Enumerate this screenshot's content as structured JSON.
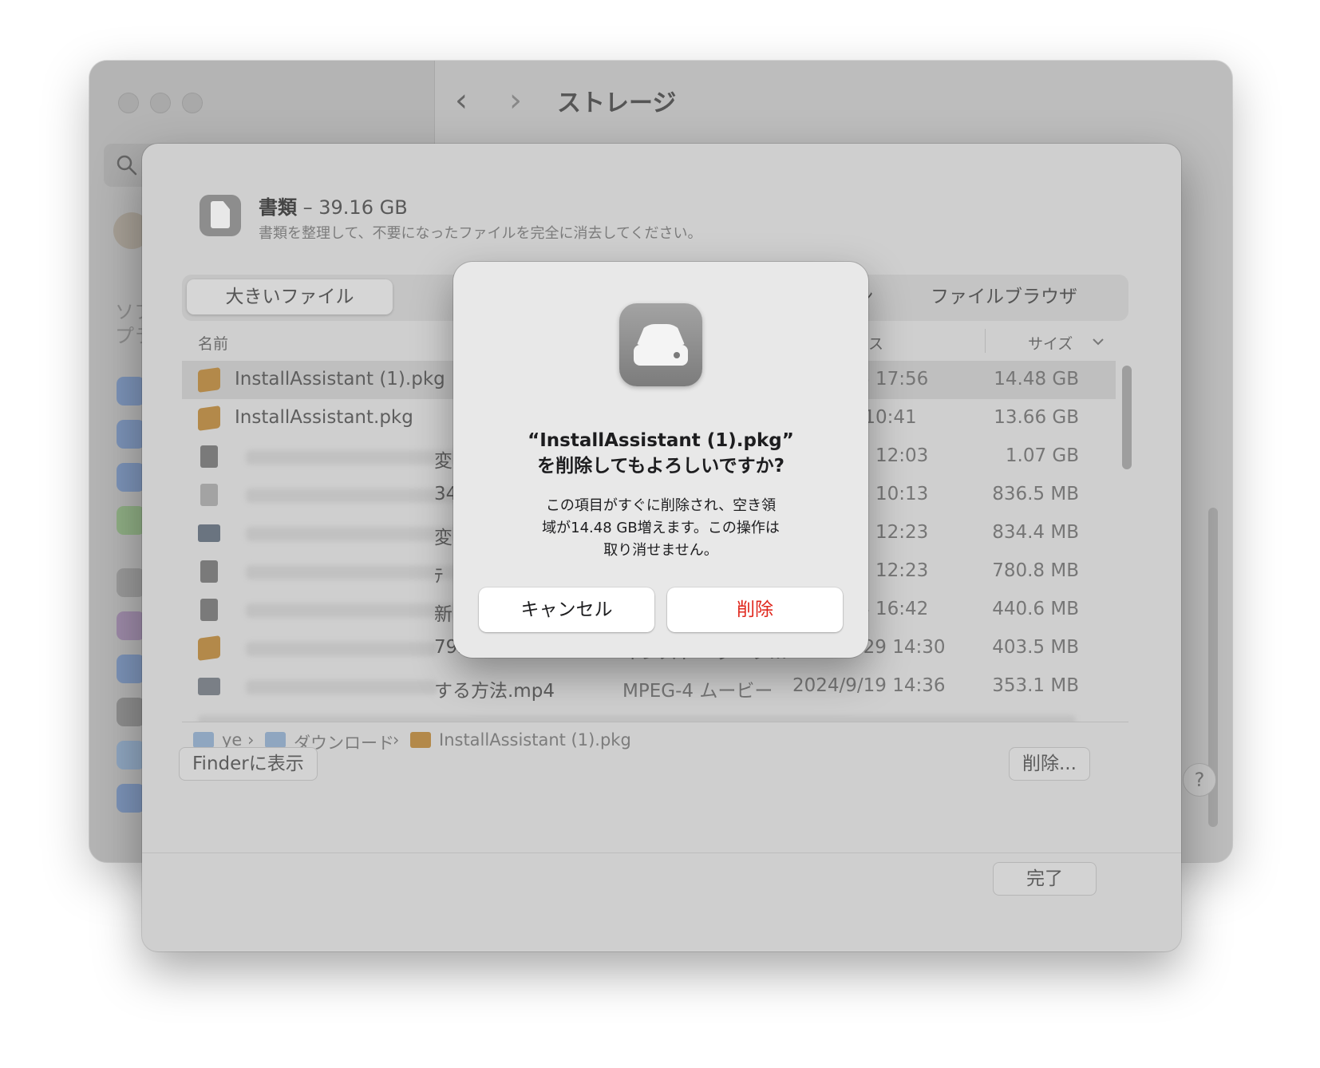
{
  "main_window": {
    "title": "ストレージ",
    "nav_back": "‹",
    "nav_forward": "›",
    "sidebar_text": [
      "ソフ",
      "プラ"
    ]
  },
  "sheet": {
    "title": "書類",
    "title_sep": " – ",
    "size": "39.16 GB",
    "subtitle": "書類を整理して、不要になったファイルを完全に消去してください。",
    "tabs": [
      "大きいファイル",
      "ン",
      "ファイルブラウザ"
    ],
    "columns": {
      "name": "名前",
      "access": "クセス",
      "size": "サイズ"
    },
    "rows": [
      {
        "name": "InstallAssistant (1).pkg",
        "kind": "",
        "date": "9/26 17:56",
        "size": "14.48 GB"
      },
      {
        "name": "InstallAssistant.pkg",
        "kind": "",
        "date": "3/7 10:41",
        "size": "13.66 GB"
      },
      {
        "name": "変",
        "kind": "",
        "date": "6/27 12:03",
        "size": "1.07 GB"
      },
      {
        "name": "34",
        "kind": "",
        "date": "6/18 10:13",
        "size": "836.5 MB"
      },
      {
        "name": "変",
        "kind": "",
        "date": "6/27 12:23",
        "size": "834.4 MB"
      },
      {
        "name": "ﾃ",
        "kind": "",
        "date": "9/19 12:23",
        "size": "780.8 MB"
      },
      {
        "name": "新",
        "kind": "",
        "date": "9/24 16:42",
        "size": "440.6 MB"
      },
      {
        "name": "792.65.pkg",
        "kind": "インストーラ・フ…",
        "date": "2024/9/29 14:30",
        "size": "403.5 MB"
      },
      {
        "name": "する方法.mp4",
        "kind": "MPEG-4 ムービー",
        "date": "2024/9/19 14:36",
        "size": "353.1 MB"
      }
    ],
    "path": [
      "ye",
      "ダウンロード",
      "InstallAssistant (1).pkg"
    ],
    "path_sep": "›",
    "finder_button": "Finderに表示",
    "delete_button": "削除...",
    "done_button": "完了"
  },
  "alert": {
    "title_line1": "“InstallAssistant (1).pkg”",
    "title_line2": "を削除してもよろしいですか?",
    "msg_line1": "この項目がすぐに削除され、空き領",
    "msg_line2": "域が14.48 GB増えます。この操作は",
    "msg_line3": "取り消せません。",
    "cancel": "キャンセル",
    "delete": "削除",
    "delete_color": "#e0281e"
  }
}
